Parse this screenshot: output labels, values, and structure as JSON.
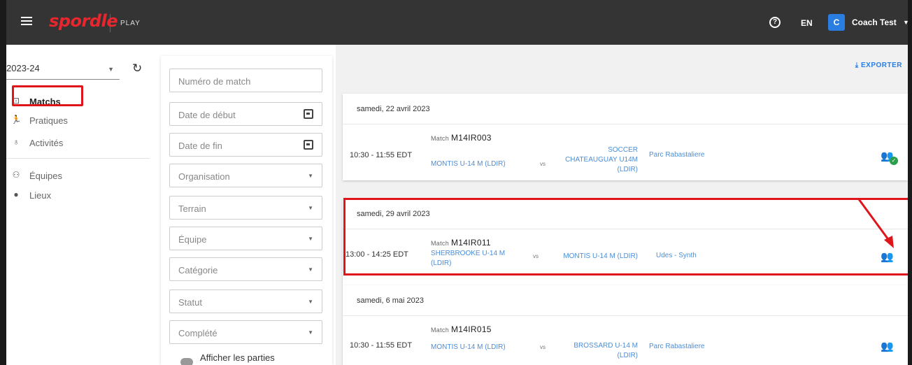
{
  "topbar": {
    "brand": "spordle",
    "product": "PLAY",
    "help_icon": "question-circle-icon",
    "lang": "EN",
    "avatar_initial": "C",
    "user_name": "Coach Test"
  },
  "sidebar": {
    "season": "2023-24",
    "items": [
      {
        "label": "Matchs",
        "icon": "match-icon"
      },
      {
        "label": "Pratiques",
        "icon": "running-icon"
      },
      {
        "label": "Activités",
        "icon": "activity-icon"
      },
      {
        "label": "Équipes",
        "icon": "teams-icon"
      },
      {
        "label": "Lieux",
        "icon": "location-pin-icon"
      }
    ]
  },
  "filters": {
    "match_number": "Numéro de match",
    "start_date": "Date de début",
    "end_date": "Date de fin",
    "organisation": "Organisation",
    "terrain": "Terrain",
    "equipe": "Équipe",
    "categorie": "Catégorie",
    "statut": "Statut",
    "complete": "Complété",
    "show_games": "Afficher les parties"
  },
  "main": {
    "export_label": "EXPORTER",
    "games": [
      {
        "date": "samedi, 22 avril 2023",
        "time": "10:30 - 11:55 EDT",
        "match_label": "Match",
        "match_code": "M14IR003",
        "home": "MONTIS U-14 M (LDIR)",
        "vs": "vs",
        "away": "SOCCER CHATEAUGUAY U14M (LDIR)",
        "venue": "Parc Rabastaliere"
      },
      {
        "date": "samedi, 29 avril 2023",
        "time": "13:00 - 14:25 EDT",
        "match_label": "Match",
        "match_code": "M14IR011",
        "home": "SHERBROOKE U-14 M (LDIR)",
        "vs": "vs",
        "away": "MONTIS U-14 M (LDIR)",
        "venue": "Udes - Synth"
      },
      {
        "date": "samedi, 6 mai 2023",
        "time": "10:30 - 11:55 EDT",
        "match_label": "Match",
        "match_code": "M14IR015",
        "home": "MONTIS U-14 M (LDIR)",
        "vs": "vs",
        "away": "BROSSARD U-14 M (LDIR)",
        "venue": "Parc Rabastaliere"
      }
    ]
  },
  "colors": {
    "topbar": "#343434",
    "brand_red": "#e8262e",
    "link_blue": "#4a8ed8",
    "highlight_red": "#e0151c",
    "confirmed_green": "#2aa04a"
  }
}
